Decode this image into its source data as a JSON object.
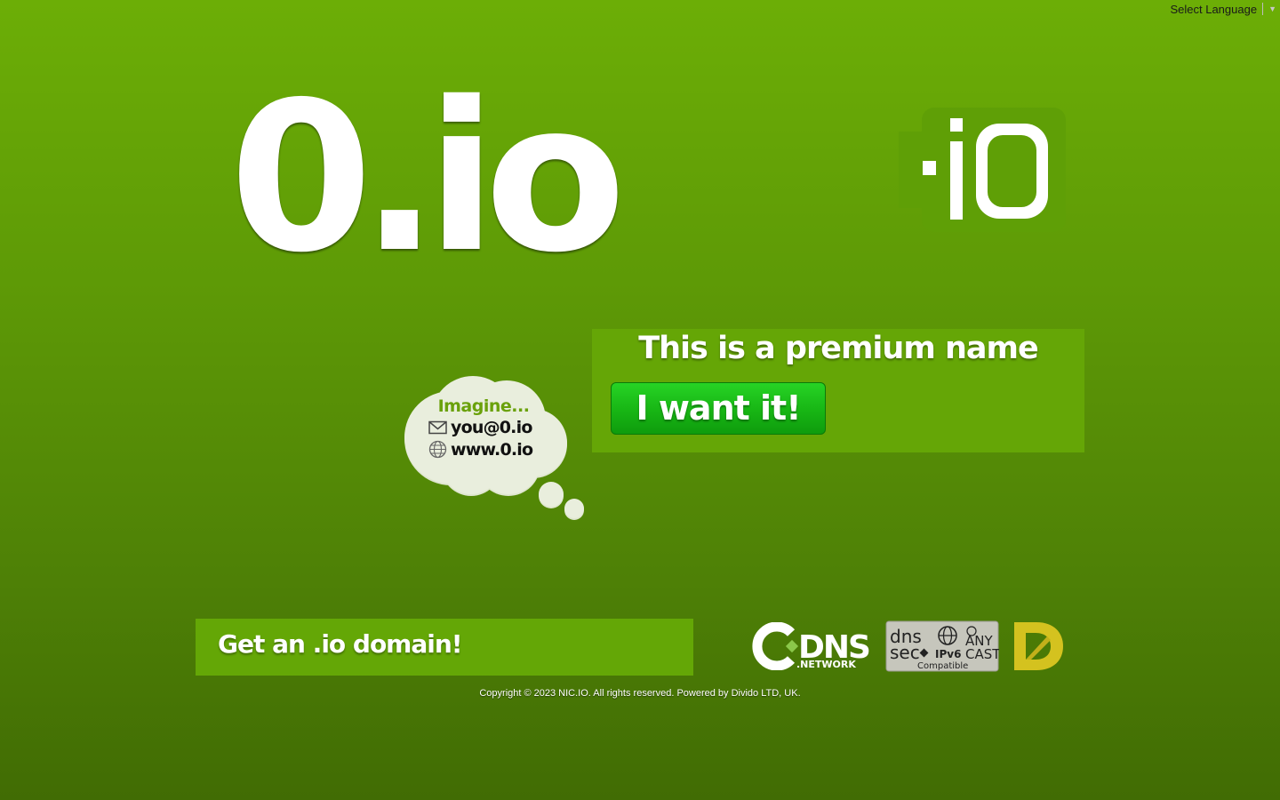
{
  "language_selector": {
    "label": "Select Language",
    "arrow": "▼"
  },
  "domain": {
    "name": "0.io"
  },
  "logo": {
    "text": "iO"
  },
  "premium": {
    "title": "This is a premium name",
    "button_label": "I want it!"
  },
  "thought_bubble": {
    "heading": "Imagine...",
    "email": "you@0.io",
    "website": "www.0.io",
    "icons": [
      "mail-icon",
      "globe-icon"
    ]
  },
  "get_domain": {
    "label": "Get an .io domain!"
  },
  "badges": {
    "cdns_main": "DNS",
    "cdns_sub": ".NETWORK",
    "dnssec_a": "dns",
    "dnssec_b": "sec",
    "ipv6": "IPv6",
    "anycast_a": "ANY",
    "anycast_b": "CAST",
    "compatible": "Compatible"
  },
  "footer": {
    "copyright": "Copyright © 2023 NIC.IO. All rights reserved. Powered by Divido LTD, UK."
  },
  "colors": {
    "background_top": "#6cae06",
    "background_bottom": "#416c04",
    "panel": "#65a606",
    "button": "#17b514",
    "bubble": "#e9eedd",
    "imagine_text": "#6aa10b",
    "divido_yellow": "#d4c21f"
  }
}
